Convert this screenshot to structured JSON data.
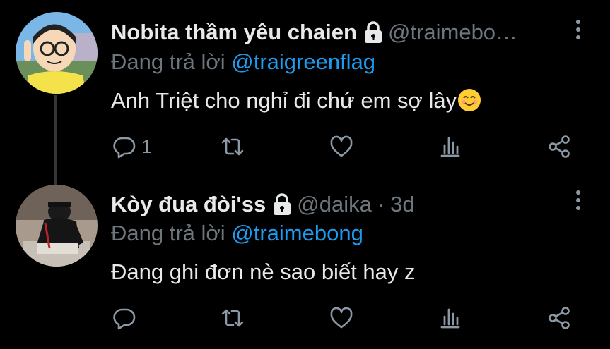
{
  "tweets": [
    {
      "display_name": "Nobita thầm yêu chaien",
      "handle": "@traimebo…",
      "time": "",
      "reply_prefix": "Đang trả lời",
      "reply_to": "@traigreenflag",
      "text": "Anh Triệt cho nghỉ đi chứ em sợ lây",
      "emoji": "smiling-face-emoji",
      "reply_count": "1",
      "protected": true
    },
    {
      "display_name": "Kòy đua đòi'ss",
      "handle": "@daika",
      "time": "3d",
      "separator": "·",
      "reply_prefix": "Đang trả lời",
      "reply_to": "@traimebong",
      "text": "Đang ghi đơn nè sao biết hay z",
      "reply_count": "",
      "protected": true
    }
  ],
  "colors": {
    "background": "#000000",
    "text": "#e7e9ea",
    "secondary": "#6e767d",
    "accent": "#1d9bf0",
    "icon": "#8b98a5"
  },
  "icons": [
    "lock-icon",
    "more-icon",
    "reply-icon",
    "retweet-icon",
    "like-icon",
    "stats-icon",
    "share-icon"
  ]
}
